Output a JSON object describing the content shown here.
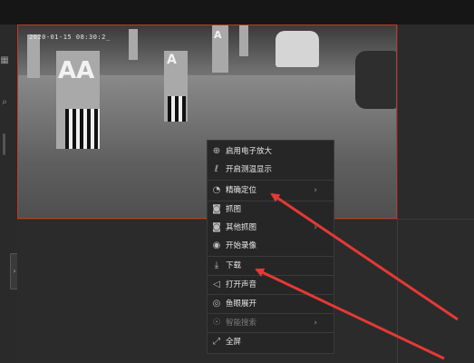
{
  "video": {
    "timestamp": "2020-01-15 08:30:2_",
    "pillar_label": "A",
    "pillar_label_large": "AA",
    "border_color": "#c0392b"
  },
  "context_menu": {
    "items": [
      {
        "label": "启用电子放大",
        "icon": "zoom-icon",
        "glyph": "⊕",
        "has_submenu": false,
        "disabled": false
      },
      {
        "label": "开启测温显示",
        "icon": "thermometer-icon",
        "glyph": "🌡",
        "has_submenu": false,
        "disabled": false
      },
      {
        "label": "精确定位",
        "icon": "stopwatch-icon",
        "glyph": "⏱",
        "has_submenu": true,
        "disabled": false
      },
      {
        "label": "抓图",
        "icon": "camera-icon",
        "glyph": "◙",
        "has_submenu": false,
        "disabled": false
      },
      {
        "label": "其他抓图",
        "icon": "camera-more-icon",
        "glyph": "◙",
        "has_submenu": true,
        "disabled": false
      },
      {
        "label": "开始录像",
        "icon": "record-icon",
        "glyph": "◉",
        "has_submenu": false,
        "disabled": false
      },
      {
        "label": "下载",
        "icon": "download-icon",
        "glyph": "⤓",
        "has_submenu": false,
        "disabled": false
      },
      {
        "label": "打开声音",
        "icon": "speaker-muted-icon",
        "glyph": "◁×",
        "has_submenu": false,
        "disabled": false
      },
      {
        "label": "鱼眼展开",
        "icon": "fisheye-icon",
        "glyph": "◎",
        "has_submenu": false,
        "disabled": false
      },
      {
        "label": "智能搜索",
        "icon": "smart-search-icon",
        "glyph": "☉",
        "has_submenu": true,
        "disabled": true
      },
      {
        "label": "全屏",
        "icon": "fullscreen-icon",
        "glyph": "⛶",
        "has_submenu": false,
        "disabled": false
      }
    ]
  },
  "annotation_color": "#e53935"
}
